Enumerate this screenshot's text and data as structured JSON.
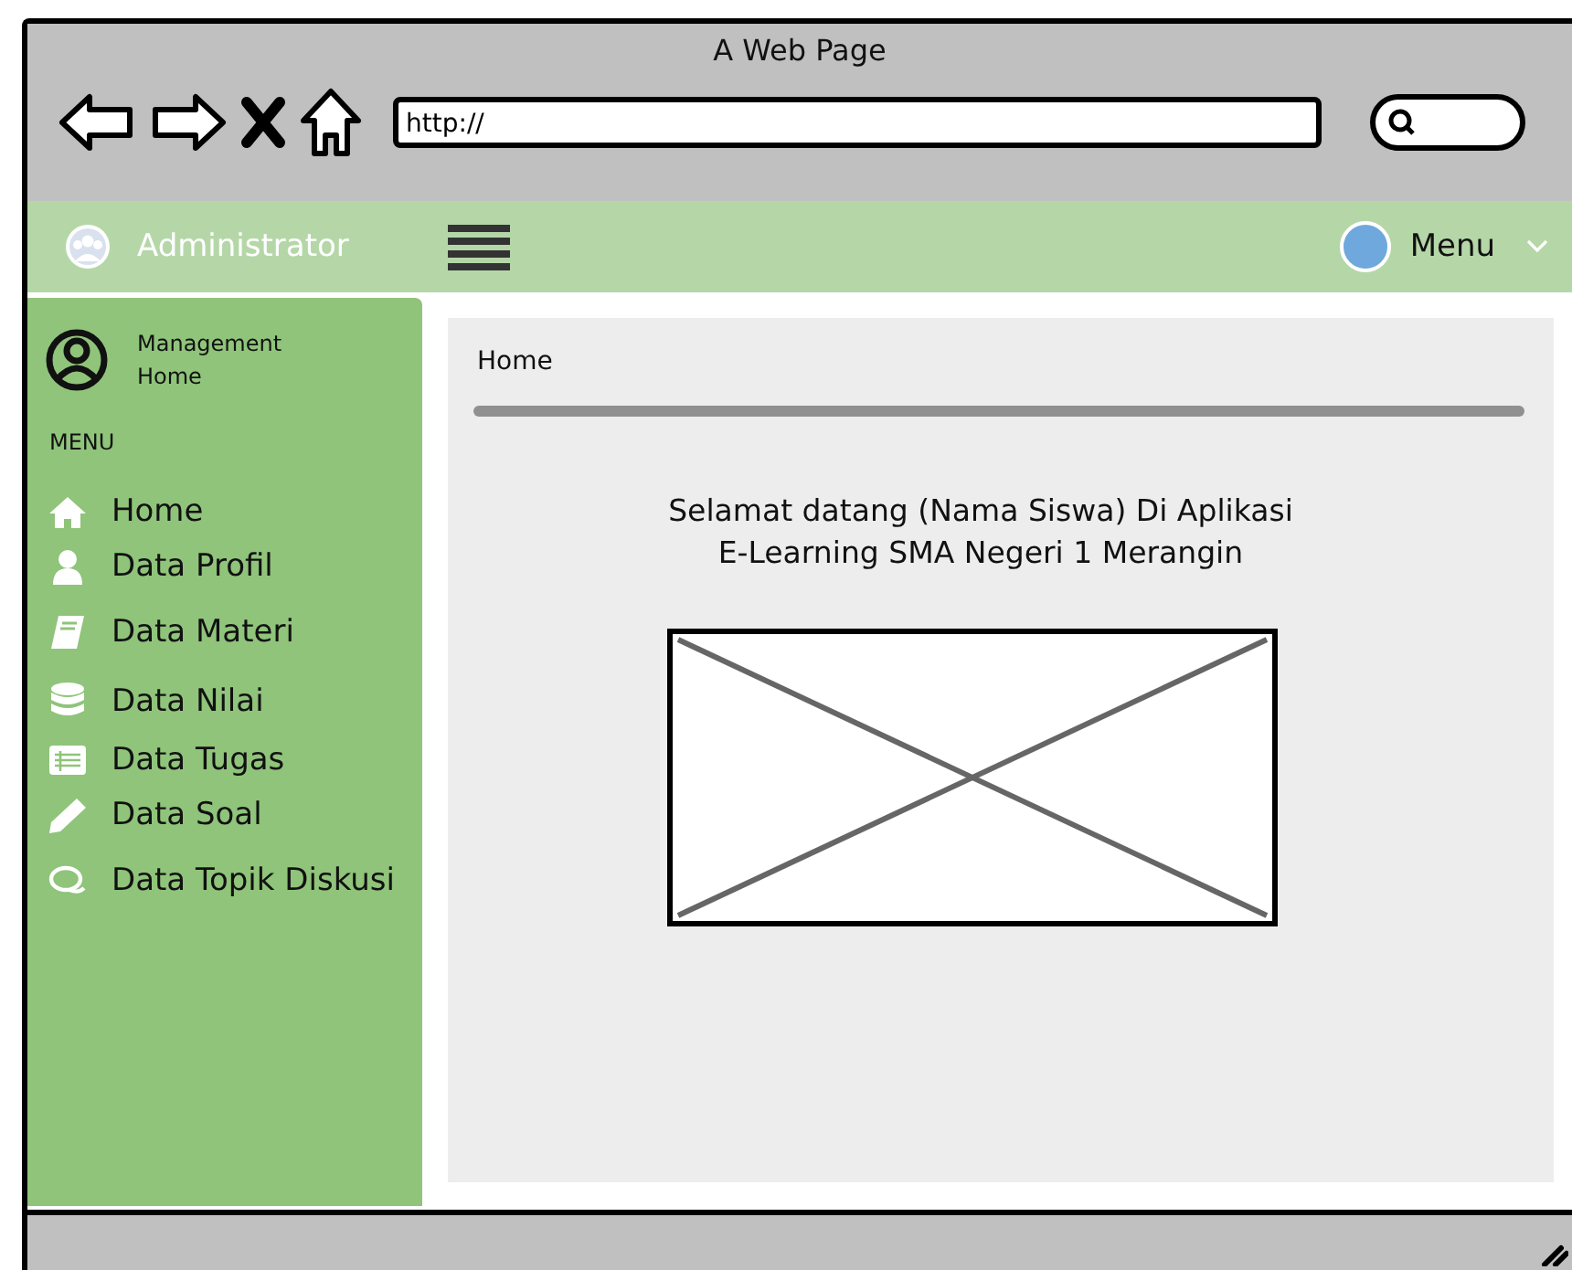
{
  "browser": {
    "title": "A Web Page",
    "url": "http://"
  },
  "header": {
    "brand": "Administrator",
    "menu": "Menu"
  },
  "sidebar": {
    "user": [
      "Management",
      "Home"
    ],
    "section": "MENU",
    "items": [
      {
        "label": "Home"
      },
      {
        "label": "Data Profil"
      },
      {
        "label": "Data Materi"
      },
      {
        "label": "Data Nilai"
      },
      {
        "label": "Data Tugas"
      },
      {
        "label": "Data Soal"
      },
      {
        "label": "Data Topik Diskusi"
      }
    ]
  },
  "breadcrumb": "Home",
  "welcome": [
    "Selamat datang (Nama Siswa) Di Aplikasi",
    "E-Learning SMA Negeri 1 Merangin"
  ]
}
